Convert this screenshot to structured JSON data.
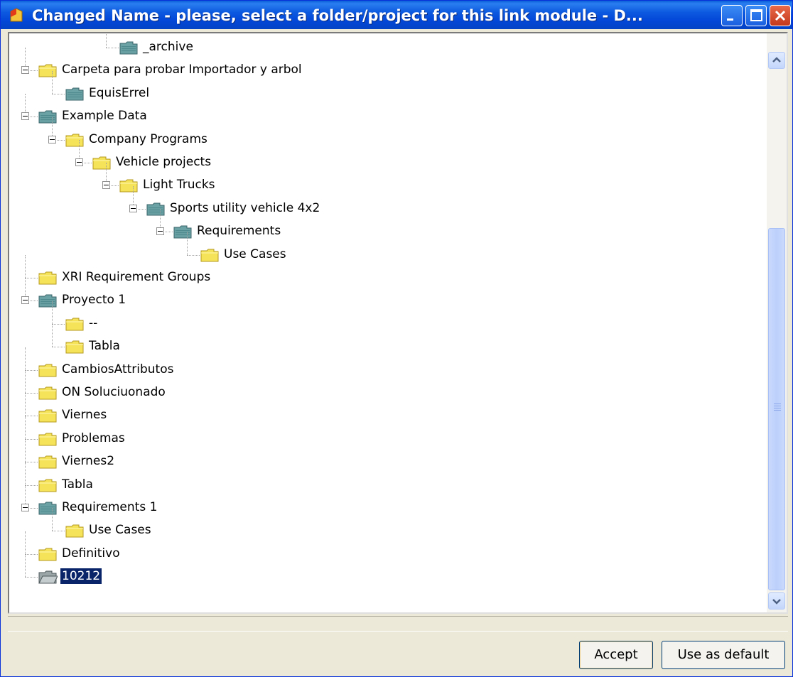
{
  "window": {
    "title": "Changed Name - please, select a folder/project for this link module - D...",
    "controls": {
      "minimize": "minimize-icon",
      "maximize": "maximize-icon",
      "close": "close-icon"
    }
  },
  "tree": {
    "items": [
      {
        "label": "_archive",
        "icon": "project-icon"
      },
      {
        "label": "Carpeta para probar Importador y arbol",
        "icon": "folder-icon",
        "expanded": true
      },
      {
        "label": "EquisErrel",
        "icon": "project-icon"
      },
      {
        "label": "Example Data",
        "icon": "project-icon",
        "expanded": true
      },
      {
        "label": "Company Programs",
        "icon": "folder-icon",
        "expanded": true
      },
      {
        "label": "Vehicle projects",
        "icon": "folder-icon",
        "expanded": true
      },
      {
        "label": "Light Trucks",
        "icon": "folder-icon",
        "expanded": true
      },
      {
        "label": "Sports utility vehicle 4x2",
        "icon": "project-icon",
        "expanded": true
      },
      {
        "label": "Requirements",
        "icon": "project-icon",
        "expanded": true
      },
      {
        "label": "Use Cases",
        "icon": "folder-icon"
      },
      {
        "label": "XRI Requirement Groups",
        "icon": "folder-icon"
      },
      {
        "label": "Proyecto 1",
        "icon": "project-icon",
        "expanded": true
      },
      {
        "label": "--",
        "icon": "folder-icon"
      },
      {
        "label": "Tabla",
        "icon": "folder-icon"
      },
      {
        "label": "CambiosAttributos",
        "icon": "folder-icon"
      },
      {
        "label": "ON Soluciuonado",
        "icon": "folder-icon"
      },
      {
        "label": "Viernes",
        "icon": "folder-icon"
      },
      {
        "label": "Problemas",
        "icon": "folder-icon"
      },
      {
        "label": "Viernes2",
        "icon": "folder-icon"
      },
      {
        "label": "Tabla",
        "icon": "folder-icon"
      },
      {
        "label": "Requirements 1",
        "icon": "project-icon",
        "expanded": true
      },
      {
        "label": "Use Cases",
        "icon": "folder-icon"
      },
      {
        "label": "Definitivo",
        "icon": "folder-icon"
      },
      {
        "label": "10212",
        "icon": "open-project-icon",
        "selected": true
      }
    ]
  },
  "buttons": {
    "accept": "Accept",
    "use_default": "Use as default"
  }
}
